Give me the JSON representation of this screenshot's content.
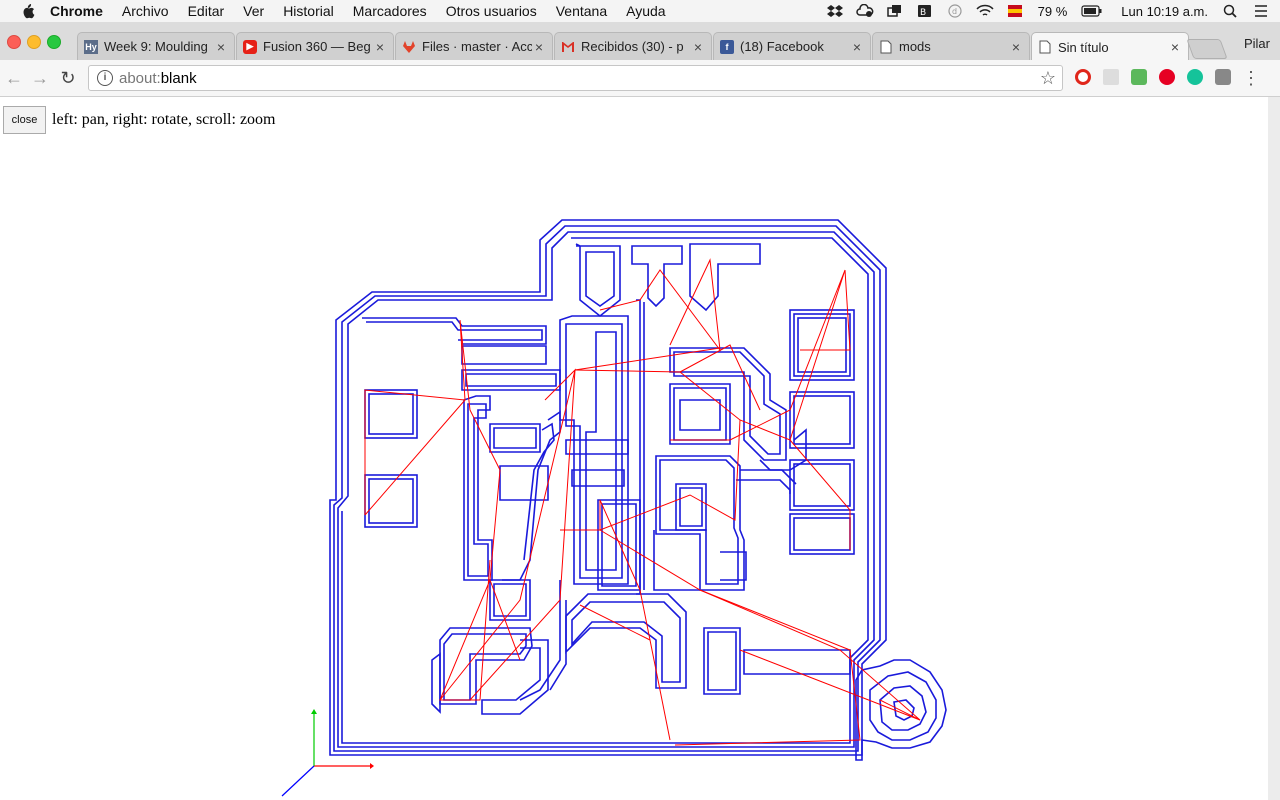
{
  "menubar": {
    "app_name": "Chrome",
    "items": [
      "Archivo",
      "Editar",
      "Ver",
      "Historial",
      "Marcadores",
      "Otros usuarios",
      "Ventana",
      "Ayuda"
    ],
    "status": {
      "battery": "79 %",
      "clock": "Lun 10:19 a.m."
    }
  },
  "browser": {
    "tabs": [
      {
        "title": "Week 9: Moulding",
        "favicon": "hy-icon",
        "active": false
      },
      {
        "title": "Fusion 360 — Beg",
        "favicon": "youtube-icon",
        "active": false
      },
      {
        "title": "Files · master · Acc",
        "favicon": "gitlab-icon",
        "active": false
      },
      {
        "title": "Recibidos (30) - p",
        "favicon": "gmail-icon",
        "active": false
      },
      {
        "title": "(18) Facebook",
        "favicon": "facebook-icon",
        "active": false
      },
      {
        "title": "mods",
        "favicon": "page-icon",
        "active": false
      },
      {
        "title": "Sin título",
        "favicon": "page-icon",
        "active": true
      }
    ],
    "profile_name": "Pilar",
    "url_scheme": "about:",
    "url_path": "blank"
  },
  "page": {
    "close_label": "close",
    "hint_text": "left: pan, right: rotate, scroll: zoom"
  },
  "colors": {
    "toolpath": "#1a1adb",
    "travel_move": "#ff0000",
    "axis_x": "#ff0000",
    "axis_y": "#00cc00",
    "axis_z": "#0000ff"
  }
}
